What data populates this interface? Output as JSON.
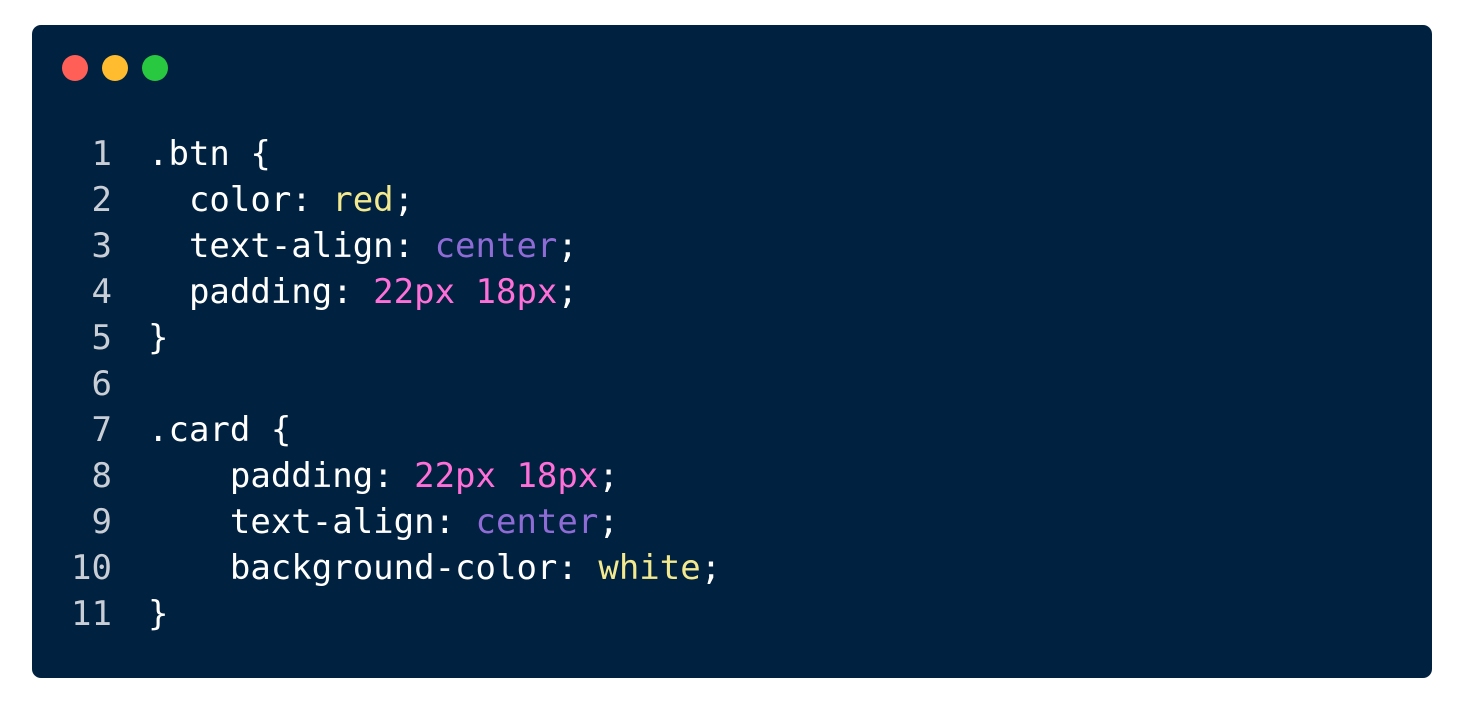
{
  "window": {
    "controls": [
      {
        "name": "close-dot",
        "color": "#ff5f57"
      },
      {
        "name": "minimize-dot",
        "color": "#febc2e"
      },
      {
        "name": "maximize-dot",
        "color": "#28c840"
      }
    ]
  },
  "colors": {
    "background": "#00213f",
    "default": "#ffffff",
    "line_number": "#c9ced6",
    "keyword_yellow": "#f3e98f",
    "keyword_purple": "#8f6bd6",
    "number_pink": "#ff6fd8"
  },
  "code_lines": [
    {
      "num": "1",
      "tokens": [
        {
          "text": ".btn {",
          "type": "default"
        }
      ]
    },
    {
      "num": "2",
      "tokens": [
        {
          "text": "  color: ",
          "type": "default"
        },
        {
          "text": "red",
          "type": "keyword_yellow"
        },
        {
          "text": ";",
          "type": "default"
        }
      ]
    },
    {
      "num": "3",
      "tokens": [
        {
          "text": "  text-align: ",
          "type": "default"
        },
        {
          "text": "center",
          "type": "keyword_purple"
        },
        {
          "text": ";",
          "type": "default"
        }
      ]
    },
    {
      "num": "4",
      "tokens": [
        {
          "text": "  padding: ",
          "type": "default"
        },
        {
          "text": "22px 18px",
          "type": "number_pink"
        },
        {
          "text": ";",
          "type": "default"
        }
      ]
    },
    {
      "num": "5",
      "tokens": [
        {
          "text": "}",
          "type": "default"
        }
      ]
    },
    {
      "num": "6",
      "tokens": [
        {
          "text": "",
          "type": "default"
        }
      ]
    },
    {
      "num": "7",
      "tokens": [
        {
          "text": ".card {",
          "type": "default"
        }
      ]
    },
    {
      "num": "8",
      "tokens": [
        {
          "text": "    padding: ",
          "type": "default"
        },
        {
          "text": "22px 18px",
          "type": "number_pink"
        },
        {
          "text": ";",
          "type": "default"
        }
      ]
    },
    {
      "num": "9",
      "tokens": [
        {
          "text": "    text-align: ",
          "type": "default"
        },
        {
          "text": "center",
          "type": "keyword_purple"
        },
        {
          "text": ";",
          "type": "default"
        }
      ]
    },
    {
      "num": "10",
      "tokens": [
        {
          "text": "    background-color: ",
          "type": "default"
        },
        {
          "text": "white",
          "type": "keyword_yellow"
        },
        {
          "text": ";",
          "type": "default"
        }
      ]
    },
    {
      "num": "11",
      "tokens": [
        {
          "text": "}",
          "type": "default"
        }
      ]
    }
  ]
}
